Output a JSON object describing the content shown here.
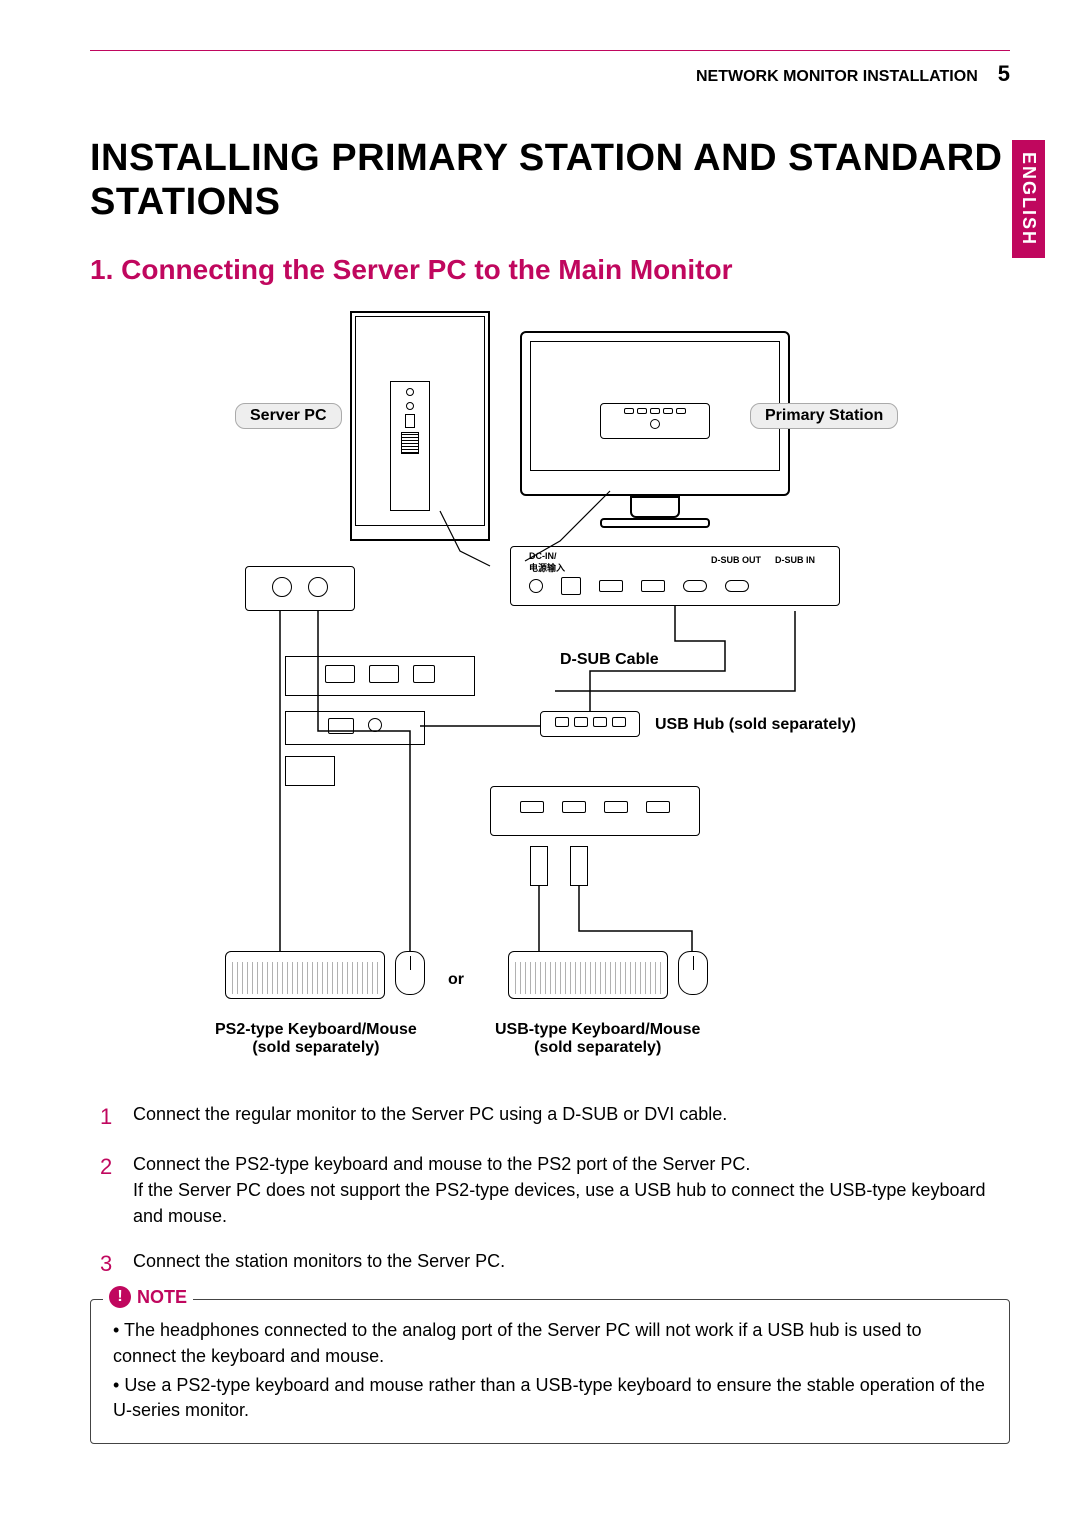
{
  "header": {
    "section": "NETWORK MONITOR INSTALLATION",
    "page": "5",
    "language": "ENGLISH"
  },
  "title": "INSTALLING PRIMARY STATION AND STANDARD STATIONS",
  "subtitle": "1. Connecting the Server PC to the Main Monitor",
  "diagram": {
    "server_pc": "Server PC",
    "primary_station": "Primary Station",
    "dsub_cable": "D-SUB Cable",
    "usb_hub": "USB Hub (sold separately)",
    "or": "or",
    "ps2_kb": "PS2-type Keyboard/Mouse",
    "ps2_kb_2": "(sold separately)",
    "usb_kb": "USB-type Keyboard/Mouse",
    "usb_kb_2": "(sold separately)",
    "ports": {
      "dcin": "DC-IN/\n电源输入",
      "dsub_out": "D-SUB OUT",
      "dsub_in": "D-SUB IN"
    }
  },
  "steps": [
    "Connect the regular monitor to the Server PC using a D-SUB or DVI cable.",
    "Connect the PS2-type keyboard and mouse to the PS2 port of the Server PC.\nIf the Server PC does not support the PS2-type devices, use a USB hub to connect the USB-type keyboard and mouse.",
    "Connect the station monitors to the Server PC."
  ],
  "note": {
    "label": "NOTE",
    "items": [
      "The headphones connected to the analog port of the Server PC will not work if a USB hub is used to connect the keyboard and mouse.",
      "Use a PS2-type keyboard and mouse rather than a USB-type keyboard to ensure the stable operation of the U-series monitor."
    ]
  }
}
